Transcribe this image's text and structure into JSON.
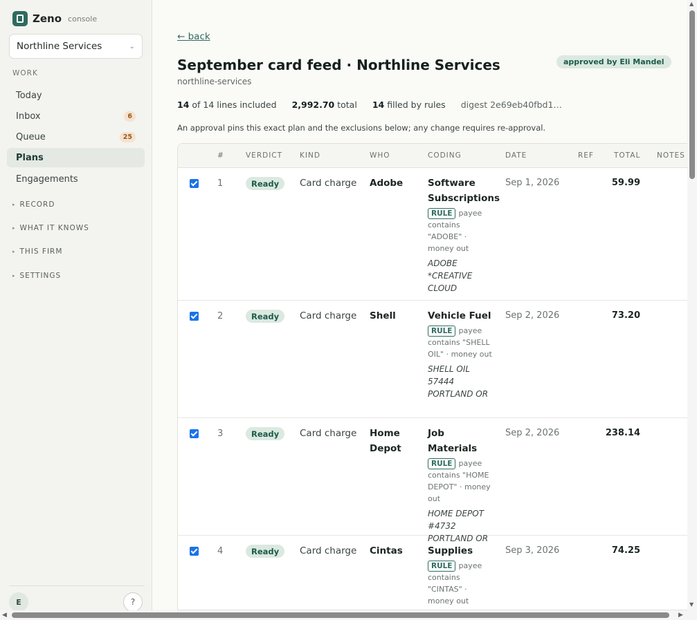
{
  "brand": {
    "name": "Zeno",
    "sub": "console"
  },
  "org": {
    "selected": "Northline Services"
  },
  "sidebar": {
    "section": "WORK",
    "items": [
      {
        "label": "Today",
        "badge": ""
      },
      {
        "label": "Inbox",
        "badge": "6"
      },
      {
        "label": "Queue",
        "badge": "25"
      },
      {
        "label": "Plans",
        "badge": ""
      },
      {
        "label": "Engagements",
        "badge": ""
      }
    ],
    "groups": [
      "RECORD",
      "WHAT IT KNOWS",
      "THIS FIRM",
      "SETTINGS"
    ],
    "avatar": "E",
    "help": "?"
  },
  "main": {
    "back": "← back",
    "title": "September card feed · Northline Services",
    "slug": "northline-services",
    "approved": "approved by Eli Mandel",
    "stats": {
      "included_n": "14",
      "included_rest": "of 14 lines included",
      "total_n": "2,992.70",
      "total_label": "total",
      "rules_n": "14",
      "rules_label": "filled by rules",
      "digest": "digest 2e69eb40fbd1…"
    },
    "note": "An approval pins this exact plan and the exclusions below; any change requires re-approval."
  },
  "table": {
    "headers": {
      "num": "#",
      "verdict": "VERDICT",
      "kind": "KIND",
      "who": "WHO",
      "coding": "CODING",
      "date": "DATE",
      "ref": "REF",
      "total": "TOTAL",
      "notes": "NOTES"
    },
    "rows": [
      {
        "num": "1",
        "verdict": "Ready",
        "kind": "Card charge",
        "who": "Adobe",
        "category": "Software Subscriptions",
        "rule_tag": "RULE",
        "rule": "payee contains \"ADOBE\" · money out",
        "desc": "ADOBE *CREATIVE CLOUD",
        "date": "Sep 1, 2026",
        "total": "59.99"
      },
      {
        "num": "2",
        "verdict": "Ready",
        "kind": "Card charge",
        "who": "Shell",
        "category": "Vehicle Fuel",
        "rule_tag": "RULE",
        "rule": "payee contains \"SHELL OIL\" · money out",
        "desc": "SHELL OIL 57444 PORTLAND OR",
        "date": "Sep 2, 2026",
        "total": "73.20"
      },
      {
        "num": "3",
        "verdict": "Ready",
        "kind": "Card charge",
        "who": "Home Depot",
        "category": "Job Materials",
        "rule_tag": "RULE",
        "rule": "payee contains \"HOME DEPOT\" · money out",
        "desc": "HOME DEPOT #4732 PORTLAND OR",
        "date": "Sep 2, 2026",
        "total": "238.14"
      },
      {
        "num": "4",
        "verdict": "Ready",
        "kind": "Card charge",
        "who": "Cintas",
        "category": "Supplies",
        "rule_tag": "RULE",
        "rule": "payee contains \"CINTAS\" · money out",
        "desc": "",
        "date": "Sep 3, 2026",
        "total": "74.25"
      }
    ]
  }
}
